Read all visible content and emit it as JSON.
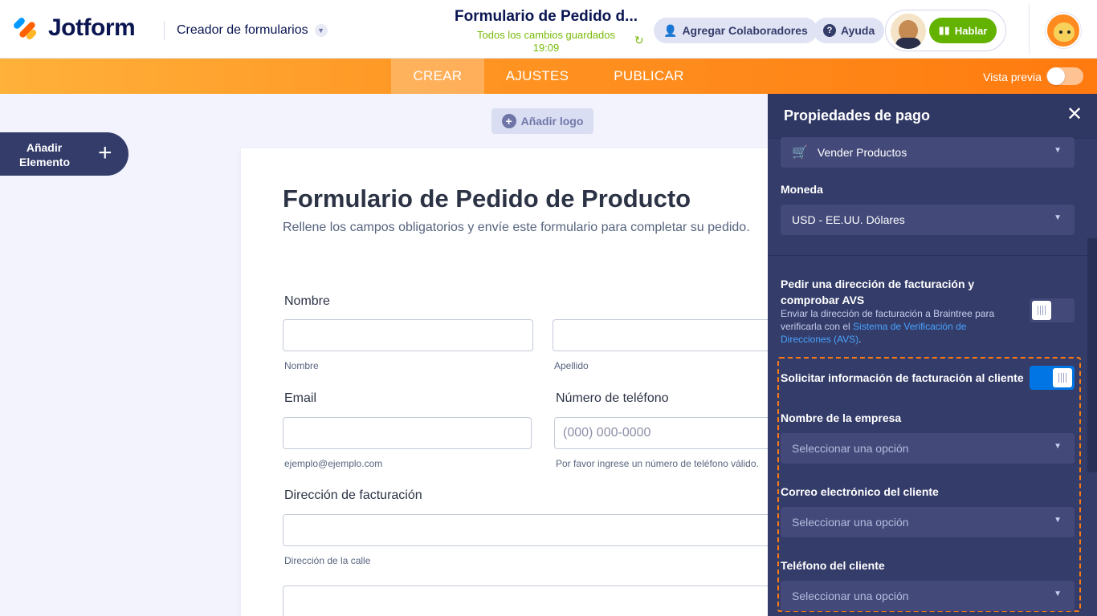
{
  "header": {
    "logo_text": "Jotform",
    "builder_label": "Creador de formularios",
    "form_title": "Formulario de Pedido d...",
    "save_status": "Todos los cambios guardados",
    "save_time": "19:09",
    "collaborators_label": "Agregar Colaboradores",
    "help_label": "Ayuda",
    "talk_label": "Hablar"
  },
  "nav": {
    "tabs": [
      {
        "label": "CREAR"
      },
      {
        "label": "AJUSTES"
      },
      {
        "label": "PUBLICAR"
      }
    ],
    "preview_label": "Vista previa"
  },
  "canvas": {
    "add_element_label": "Añadir Elemento",
    "add_logo_label": "Añadir logo",
    "form": {
      "title": "Formulario de Pedido de Producto",
      "subtitle": "Rellene los campos obligatorios y envíe este formulario para completar su pedido.",
      "name_label": "Nombre",
      "first_name_sub": "Nombre",
      "last_name_sub": "Apellido",
      "email_label": "Email",
      "email_sub": "ejemplo@ejemplo.com",
      "phone_label": "Número de teléfono",
      "phone_placeholder": "(000) 000-0000",
      "phone_sub": "Por favor ingrese un número de teléfono válido.",
      "billing_label": "Dirección de facturación",
      "street_sub": "Dirección de la calle"
    }
  },
  "panel": {
    "title": "Propiedades de pago",
    "payment_type": "Vender Productos",
    "currency_label": "Moneda",
    "currency_value": "USD - EE.UU. Dólares",
    "avs_label": "Pedir una dirección de facturación y comprobar AVS",
    "avs_desc_prefix": "Enviar la dirección de facturación a Braintree para verificarla con el ",
    "avs_desc_link": "Sistema de Verificación de Direcciones (AVS)",
    "avs_desc_suffix": ".",
    "avs_enabled": false,
    "billing_info_label": "Solicitar información de facturación al cliente",
    "billing_info_enabled": true,
    "company_label": "Nombre de la empresa",
    "company_placeholder": "Seleccionar una opción",
    "email_label": "Correo electrónico del cliente",
    "email_placeholder": "Seleccionar una opción",
    "phone_label": "Teléfono del cliente",
    "phone_placeholder": "Seleccionar una opción"
  },
  "colors": {
    "brand_navy": "#0a1551",
    "accent_orange": "#ff7a0f",
    "saved_green": "#78bb07",
    "talk_green": "#64b200",
    "panel_bg": "#343c6a",
    "toggle_on": "#0075e3"
  }
}
